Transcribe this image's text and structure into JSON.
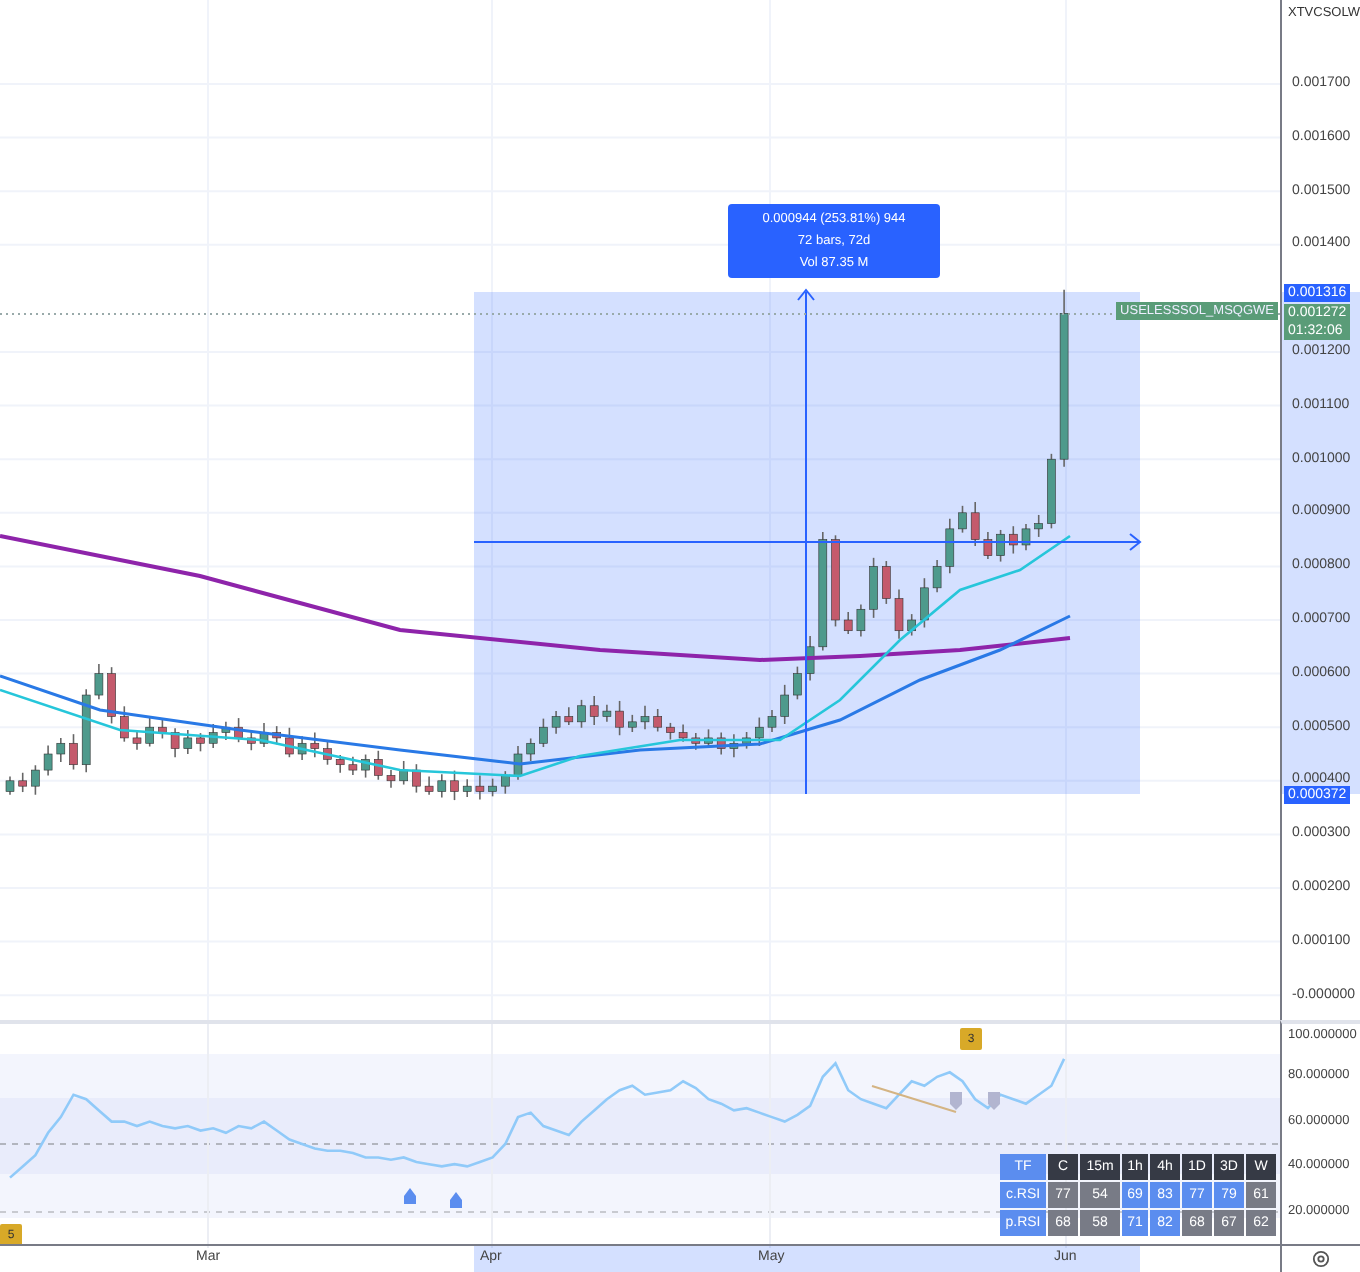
{
  "price_axis": {
    "symbol": "XTVCSOLW",
    "labels": [
      "0.001700",
      "0.001600",
      "0.001500",
      "0.001400",
      "0.001200",
      "0.001100",
      "0.001000",
      "0.000900",
      "0.000800",
      "0.000700",
      "0.000600",
      "0.000500",
      "0.000400",
      "0.000300",
      "0.000200",
      "0.000100",
      "-0.000000"
    ],
    "badges": [
      {
        "kind": "high",
        "value": "0.001316"
      },
      {
        "kind": "last",
        "value": "0.001272",
        "countdown": "01:32:06"
      },
      {
        "kind": "low",
        "value": "0.000372"
      }
    ]
  },
  "series_label": "USELESSSOL_MSQGWE",
  "measure_tooltip": {
    "lines": [
      "0.000944 (253.81%) 944",
      "72 bars, 72d",
      "Vol 87.35 M"
    ]
  },
  "rsi_pane": {
    "axis_labels": [
      "100.000000",
      "80.000000",
      "60.000000",
      "40.000000",
      "20.000000"
    ],
    "markers": [
      {
        "label": "3"
      },
      {
        "label": "5"
      }
    ],
    "table": {
      "rows": [
        {
          "cells": [
            {
              "value": "TF",
              "color": "#5b8def"
            },
            {
              "value": "C",
              "color": "#363a45"
            },
            {
              "value": "15m",
              "color": "#363a45"
            },
            {
              "value": "1h",
              "color": "#363a45"
            },
            {
              "value": "4h",
              "color": "#363a45"
            },
            {
              "value": "1D",
              "color": "#363a45"
            },
            {
              "value": "3D",
              "color": "#363a45"
            },
            {
              "value": "W",
              "color": "#363a45"
            }
          ]
        },
        {
          "cells": [
            {
              "value": "c.RSI",
              "color": "#5b8def"
            },
            {
              "value": "77",
              "color": "#787b86"
            },
            {
              "value": "54",
              "color": "#787b86"
            },
            {
              "value": "69",
              "color": "#5b8def"
            },
            {
              "value": "83",
              "color": "#5b8def"
            },
            {
              "value": "77",
              "color": "#5b8def"
            },
            {
              "value": "79",
              "color": "#5b8def"
            },
            {
              "value": "61",
              "color": "#787b86"
            }
          ]
        },
        {
          "cells": [
            {
              "value": "p.RSI",
              "color": "#5b8def"
            },
            {
              "value": "68",
              "color": "#787b86"
            },
            {
              "value": "58",
              "color": "#787b86"
            },
            {
              "value": "71",
              "color": "#5b8def"
            },
            {
              "value": "82",
              "color": "#5b8def"
            },
            {
              "value": "68",
              "color": "#787b86"
            },
            {
              "value": "67",
              "color": "#787b86"
            },
            {
              "value": "62",
              "color": "#787b86"
            }
          ]
        }
      ]
    }
  },
  "time_axis": {
    "labels": [
      "Mar",
      "Apr",
      "May",
      "Jun"
    ]
  }
}
